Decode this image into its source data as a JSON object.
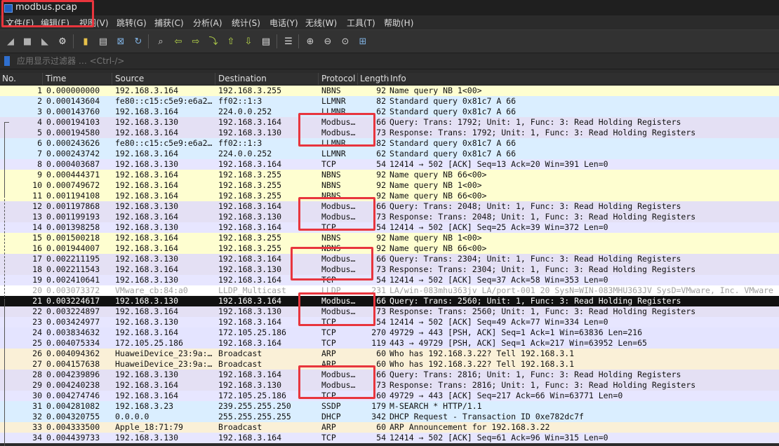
{
  "window": {
    "title": "modbus.pcap"
  },
  "menu": [
    "文件(F)",
    "编辑(E)",
    "视图(V)",
    "跳转(G)",
    "捕获(C)",
    "分析(A)",
    "统计(S)",
    "电话(Y)",
    "无线(W)",
    "工具(T)",
    "帮助(H)"
  ],
  "toolbar_icons": [
    "shark-fin-start-icon",
    "stop-square-icon",
    "restart-fin-icon",
    "options-gear-icon",
    "open-folder-icon",
    "save-file-icon",
    "close-file-icon",
    "reload-icon",
    "find-magnifier-icon",
    "go-back-arrow-icon",
    "go-forward-arrow-icon",
    "go-to-packet-icon",
    "first-packet-icon",
    "last-packet-icon",
    "auto-scroll-icon",
    "colorize-icon",
    "zoom-in-icon",
    "zoom-out-icon",
    "normal-size-icon",
    "resize-columns-icon"
  ],
  "filter": {
    "placeholder": "应用显示过滤器 … <Ctrl-/>"
  },
  "columns": {
    "no": "No.",
    "time": "Time",
    "source": "Source",
    "destination": "Destination",
    "protocol": "Protocol",
    "length": "Length",
    "info": "Info"
  },
  "colors": {
    "nbns": "#fefed0",
    "llmnr": "#daeeff",
    "modbus": "#e4e0f4",
    "tcp": "#e7e6ff",
    "tcp_push": "#e4e4ff",
    "lldp": "#ffffff",
    "arp": "#faf0d7",
    "ssdp": "#daeeff",
    "dhcp": "#daeeff",
    "selected": "#111111",
    "highlight": "#e8353d"
  },
  "packets": [
    {
      "no": "1",
      "time": "0.000000000",
      "src": "192.168.3.164",
      "dst": "192.168.3.255",
      "proto": "NBNS",
      "len": "92",
      "info": "Name query NB 1<00>",
      "color": "#fefed0"
    },
    {
      "no": "2",
      "time": "0.000143604",
      "src": "fe80::c15:c5e9:e6a2…",
      "dst": "ff02::1:3",
      "proto": "LLMNR",
      "len": "82",
      "info": "Standard query 0x81c7 A 66",
      "color": "#daeeff"
    },
    {
      "no": "3",
      "time": "0.000143760",
      "src": "192.168.3.164",
      "dst": "224.0.0.252",
      "proto": "LLMNR",
      "len": "62",
      "info": "Standard query 0x81c7 A 66",
      "color": "#daeeff"
    },
    {
      "no": "4",
      "time": "0.000194103",
      "src": "192.168.3.130",
      "dst": "192.168.3.164",
      "proto": "Modbus…",
      "len": "66",
      "info": "  Query: Trans:  1792; Unit:   1, Func:   3: Read Holding Registers",
      "color": "#e4e0f4"
    },
    {
      "no": "5",
      "time": "0.000194580",
      "src": "192.168.3.164",
      "dst": "192.168.3.130",
      "proto": "Modbus…",
      "len": "73",
      "info": "Response: Trans:  1792; Unit:   1, Func:   3: Read Holding Registers",
      "color": "#e4e0f4"
    },
    {
      "no": "6",
      "time": "0.000243626",
      "src": "fe80::c15:c5e9:e6a2…",
      "dst": "ff02::1:3",
      "proto": "LLMNR",
      "len": "82",
      "info": "Standard query 0x81c7 A 66",
      "color": "#daeeff"
    },
    {
      "no": "7",
      "time": "0.000243742",
      "src": "192.168.3.164",
      "dst": "224.0.0.252",
      "proto": "LLMNR",
      "len": "62",
      "info": "Standard query 0x81c7 A 66",
      "color": "#daeeff"
    },
    {
      "no": "8",
      "time": "0.000403687",
      "src": "192.168.3.130",
      "dst": "192.168.3.164",
      "proto": "TCP",
      "len": "54",
      "info": "12414 → 502 [ACK] Seq=13 Ack=20 Win=391 Len=0",
      "color": "#e7e6ff"
    },
    {
      "no": "9",
      "time": "0.000444371",
      "src": "192.168.3.164",
      "dst": "192.168.3.255",
      "proto": "NBNS",
      "len": "92",
      "info": "Name query NB 66<00>",
      "color": "#fefed0"
    },
    {
      "no": "10",
      "time": "0.000749672",
      "src": "192.168.3.164",
      "dst": "192.168.3.255",
      "proto": "NBNS",
      "len": "92",
      "info": "Name query NB 1<00>",
      "color": "#fefed0"
    },
    {
      "no": "11",
      "time": "0.001194108",
      "src": "192.168.3.164",
      "dst": "192.168.3.255",
      "proto": "NBNS",
      "len": "92",
      "info": "Name query NB 66<00>",
      "color": "#fefed0"
    },
    {
      "no": "12",
      "time": "0.001197868",
      "src": "192.168.3.130",
      "dst": "192.168.3.164",
      "proto": "Modbus…",
      "len": "66",
      "info": "  Query: Trans:  2048; Unit:   1, Func:   3: Read Holding Registers",
      "color": "#e4e0f4"
    },
    {
      "no": "13",
      "time": "0.001199193",
      "src": "192.168.3.164",
      "dst": "192.168.3.130",
      "proto": "Modbus…",
      "len": "73",
      "info": "Response: Trans:  2048; Unit:   1, Func:   3: Read Holding Registers",
      "color": "#e4e0f4"
    },
    {
      "no": "14",
      "time": "0.001398258",
      "src": "192.168.3.130",
      "dst": "192.168.3.164",
      "proto": "TCP",
      "len": "54",
      "info": "12414 → 502 [ACK] Seq=25 Ack=39 Win=372 Len=0",
      "color": "#e7e6ff"
    },
    {
      "no": "15",
      "time": "0.001500218",
      "src": "192.168.3.164",
      "dst": "192.168.3.255",
      "proto": "NBNS",
      "len": "92",
      "info": "Name query NB 1<00>",
      "color": "#fefed0"
    },
    {
      "no": "16",
      "time": "0.001944007",
      "src": "192.168.3.164",
      "dst": "192.168.3.255",
      "proto": "NBNS",
      "len": "92",
      "info": "Name query NB 66<00>",
      "color": "#fefed0"
    },
    {
      "no": "17",
      "time": "0.002211195",
      "src": "192.168.3.130",
      "dst": "192.168.3.164",
      "proto": "Modbus…",
      "len": "66",
      "info": "  Query: Trans:  2304; Unit:   1, Func:   3: Read Holding Registers",
      "color": "#e4e0f4"
    },
    {
      "no": "18",
      "time": "0.002211543",
      "src": "192.168.3.164",
      "dst": "192.168.3.130",
      "proto": "Modbus…",
      "len": "73",
      "info": "Response: Trans:  2304; Unit:   1, Func:   3: Read Holding Registers",
      "color": "#e4e0f4"
    },
    {
      "no": "19",
      "time": "0.002410641",
      "src": "192.168.3.130",
      "dst": "192.168.3.164",
      "proto": "TCP",
      "len": "54",
      "info": "12414 → 502 [ACK] Seq=37 Ack=58 Win=353 Len=0",
      "color": "#e7e6ff"
    },
    {
      "no": "20",
      "time": "0.003073372",
      "src": "VMware_cb:84:a0",
      "dst": "LLDP_Multicast",
      "proto": "LLDP",
      "len": "231",
      "info": "LA/win-083mhu363jv LA/port-001 20 SysN=WIN-083MHU363JV SysD=VMware, Inc. VMware",
      "color": "#ffffff",
      "dim": true
    },
    {
      "no": "21",
      "time": "0.003224617",
      "src": "192.168.3.130",
      "dst": "192.168.3.164",
      "proto": "Modbus…",
      "len": "66",
      "info": "  Query: Trans:  2560; Unit:   1, Func:   3: Read Holding Registers",
      "color": "#111111",
      "selected": true
    },
    {
      "no": "22",
      "time": "0.003224897",
      "src": "192.168.3.164",
      "dst": "192.168.3.130",
      "proto": "Modbus…",
      "len": "73",
      "info": "Response: Trans:  2560; Unit:   1, Func:   3: Read Holding Registers",
      "color": "#e4e0f4"
    },
    {
      "no": "23",
      "time": "0.003424977",
      "src": "192.168.3.130",
      "dst": "192.168.3.164",
      "proto": "TCP",
      "len": "54",
      "info": "12414 → 502 [ACK] Seq=49 Ack=77 Win=334 Len=0",
      "color": "#e7e6ff"
    },
    {
      "no": "24",
      "time": "0.003834632",
      "src": "192.168.3.164",
      "dst": "172.105.25.186",
      "proto": "TCP",
      "len": "270",
      "info": "49729 → 443 [PSH, ACK] Seq=1 Ack=1 Win=63836 Len=216",
      "color": "#e4e4ff"
    },
    {
      "no": "25",
      "time": "0.004075334",
      "src": "172.105.25.186",
      "dst": "192.168.3.164",
      "proto": "TCP",
      "len": "119",
      "info": "443 → 49729 [PSH, ACK] Seq=1 Ack=217 Win=63952 Len=65",
      "color": "#e4e4ff"
    },
    {
      "no": "26",
      "time": "0.004094362",
      "src": "HuaweiDevice_23:9a:…",
      "dst": "Broadcast",
      "proto": "ARP",
      "len": "60",
      "info": "Who has 192.168.3.22? Tell 192.168.3.1",
      "color": "#faf0d7"
    },
    {
      "no": "27",
      "time": "0.004157638",
      "src": "HuaweiDevice_23:9a:…",
      "dst": "Broadcast",
      "proto": "ARP",
      "len": "60",
      "info": "Who has 192.168.3.22? Tell 192.168.3.1",
      "color": "#faf0d7"
    },
    {
      "no": "28",
      "time": "0.004239896",
      "src": "192.168.3.130",
      "dst": "192.168.3.164",
      "proto": "Modbus…",
      "len": "66",
      "info": "  Query: Trans:  2816; Unit:   1, Func:   3: Read Holding Registers",
      "color": "#e4e0f4"
    },
    {
      "no": "29",
      "time": "0.004240238",
      "src": "192.168.3.164",
      "dst": "192.168.3.130",
      "proto": "Modbus…",
      "len": "73",
      "info": "Response: Trans:  2816; Unit:   1, Func:   3: Read Holding Registers",
      "color": "#e4e0f4"
    },
    {
      "no": "30",
      "time": "0.004274746",
      "src": "192.168.3.164",
      "dst": "172.105.25.186",
      "proto": "TCP",
      "len": "60",
      "info": "49729 → 443 [ACK] Seq=217 Ack=66 Win=63771 Len=0",
      "color": "#e7e6ff"
    },
    {
      "no": "31",
      "time": "0.004281082",
      "src": "192.168.3.23",
      "dst": "239.255.255.250",
      "proto": "SSDP",
      "len": "179",
      "info": "M-SEARCH * HTTP/1.1",
      "color": "#daeeff"
    },
    {
      "no": "32",
      "time": "0.004320755",
      "src": "0.0.0.0",
      "dst": "255.255.255.255",
      "proto": "DHCP",
      "len": "342",
      "info": "DHCP Request  - Transaction ID 0xe782dc7f",
      "color": "#daeeff"
    },
    {
      "no": "33",
      "time": "0.004333500",
      "src": "Apple_18:71:79",
      "dst": "Broadcast",
      "proto": "ARP",
      "len": "60",
      "info": "ARP Announcement for 192.168.3.22",
      "color": "#faf0d7"
    },
    {
      "no": "34",
      "time": "0.004439733",
      "src": "192.168.3.130",
      "dst": "192.168.3.164",
      "proto": "TCP",
      "len": "54",
      "info": "12414 → 502 [ACK] Seq=61 Ack=96 Win=315 Len=0",
      "color": "#e7e6ff"
    }
  ]
}
